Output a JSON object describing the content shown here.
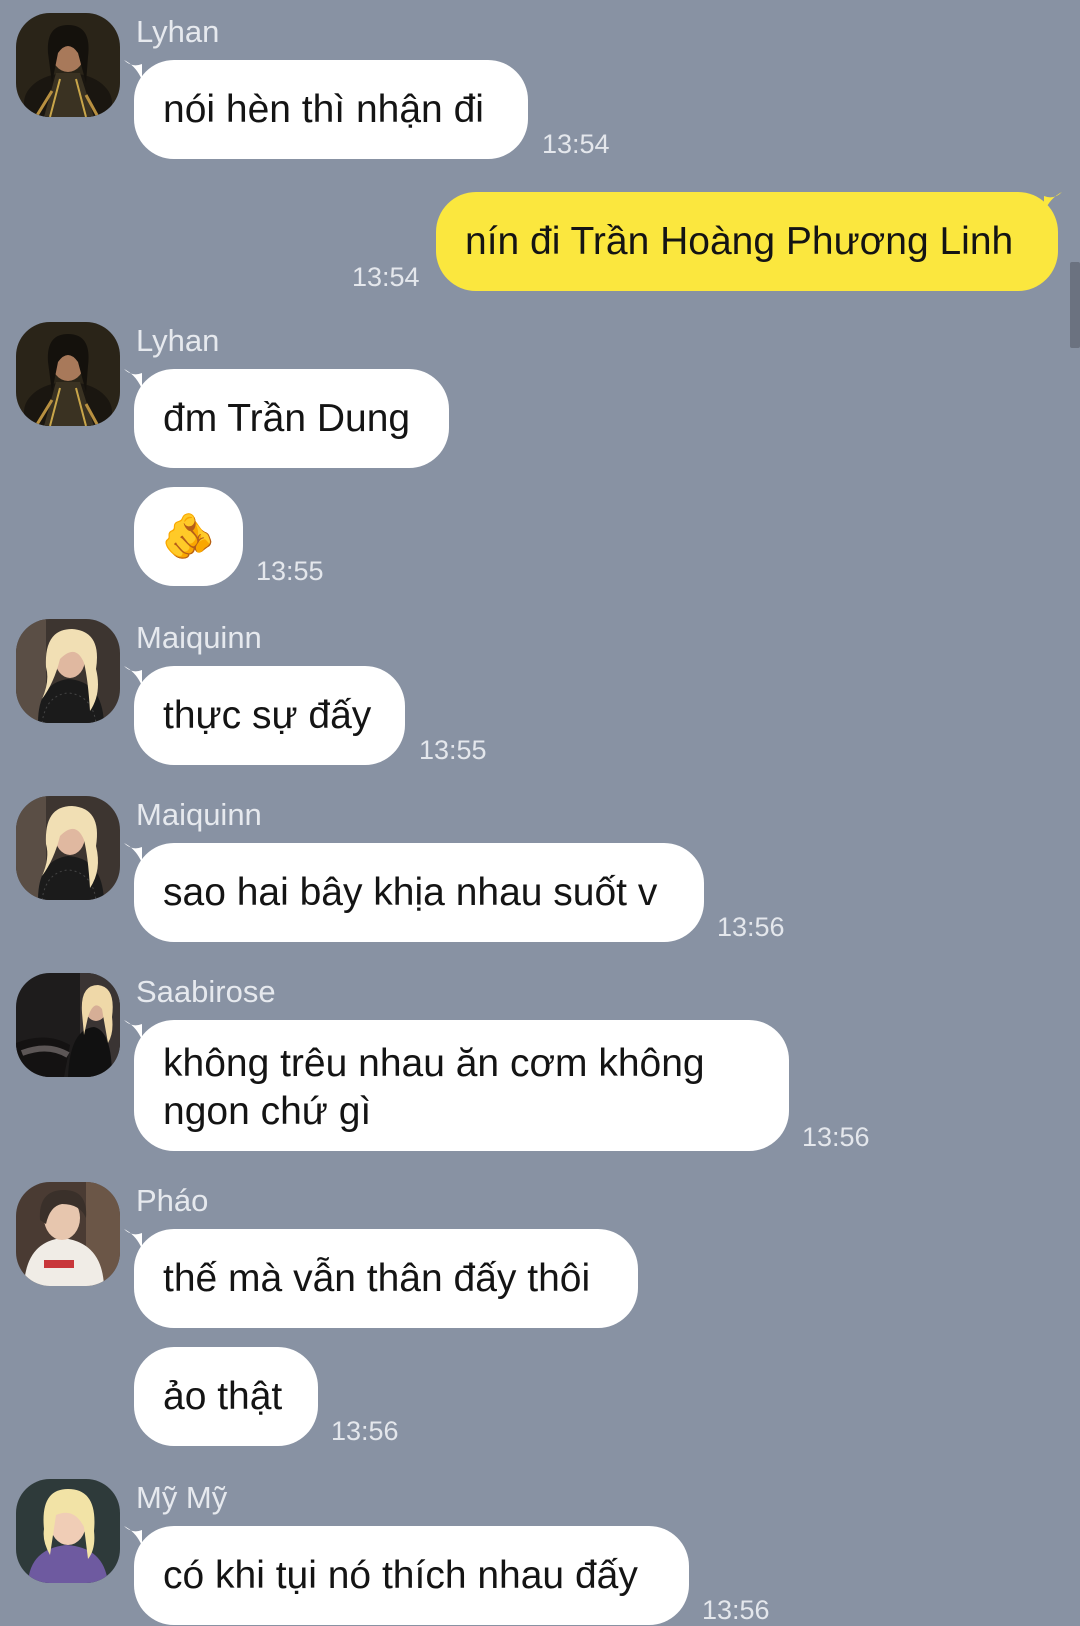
{
  "messages": [
    {
      "sender": "Lyhan",
      "text": "nói hèn thì nhận đi",
      "time": "13:54"
    },
    {
      "sender": "",
      "text": "nín đi Trần Hoàng Phương Linh",
      "time": "13:54",
      "mine": true
    },
    {
      "sender": "Lyhan",
      "text": "đm Trần Dung",
      "time": ""
    },
    {
      "sender": "",
      "text": "🫵",
      "time": "13:55",
      "emoji_name": "pointing-at-viewer-emoji"
    },
    {
      "sender": "Maiquinn",
      "text": "thực sự đấy",
      "time": "13:55"
    },
    {
      "sender": "Maiquinn",
      "text": "sao hai bây khịa nhau suốt v",
      "time": "13:56"
    },
    {
      "sender": "Saabirose",
      "text": "không trêu nhau ăn cơm không ngon chứ gì",
      "time": "13:56"
    },
    {
      "sender": "Pháo",
      "text": "thế mà vẫn thân đấy thôi",
      "time": ""
    },
    {
      "sender": "",
      "text": "ảo thật",
      "time": "13:56"
    },
    {
      "sender": "Mỹ Mỹ",
      "text": "có khi tụi nó thích nhau đấy",
      "time": "13:56"
    }
  ],
  "colors": {
    "background": "#8892a3",
    "incoming_bubble": "#ffffff",
    "outgoing_bubble": "#fbe73e",
    "meta_text": "#e4e7ec"
  }
}
